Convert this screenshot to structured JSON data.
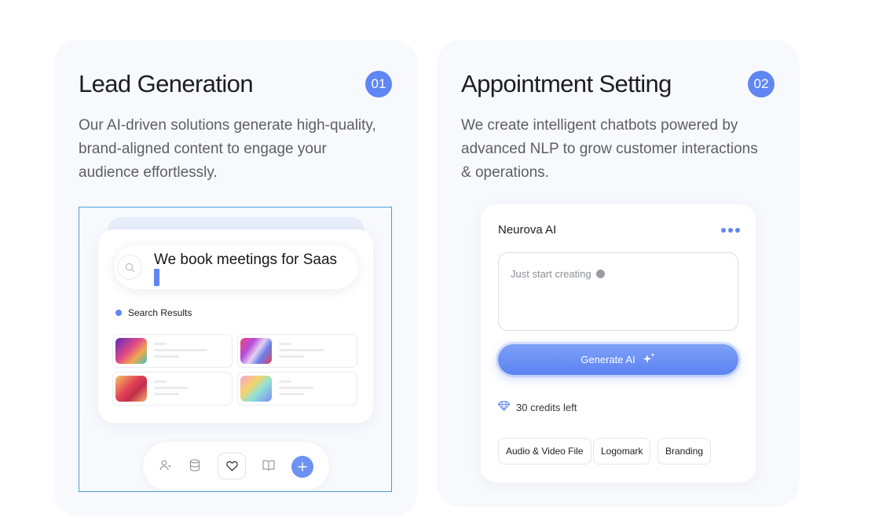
{
  "lead": {
    "title": "Lead Generation",
    "badge": "01",
    "description": "Our AI-driven solutions generate high-quality, brand-aligned content to engage your audience effortlessly.",
    "search_text": "We book meetings for Saas",
    "results_label": "Search Results",
    "bottom_bar_icons": [
      "user-icon",
      "database-icon",
      "heart-icon",
      "book-icon",
      "plus-icon"
    ]
  },
  "appointment": {
    "title": "Appointment Setting",
    "badge": "02",
    "description": "We create intelligent chatbots powered by advanced NLP to grow customer interactions & operations.",
    "chat_title": "Neurova AI",
    "input_placeholder": "Just start creating",
    "generate_button": "Generate AI",
    "credits": "30 credits left",
    "tags": [
      "Audio & Video File",
      "Logomark",
      "Branding"
    ]
  },
  "colors": {
    "accent": "#5f86f2",
    "card_bg": "#f8f9fd",
    "text_dark": "#1d1d22",
    "text_muted": "#5c5f68"
  }
}
